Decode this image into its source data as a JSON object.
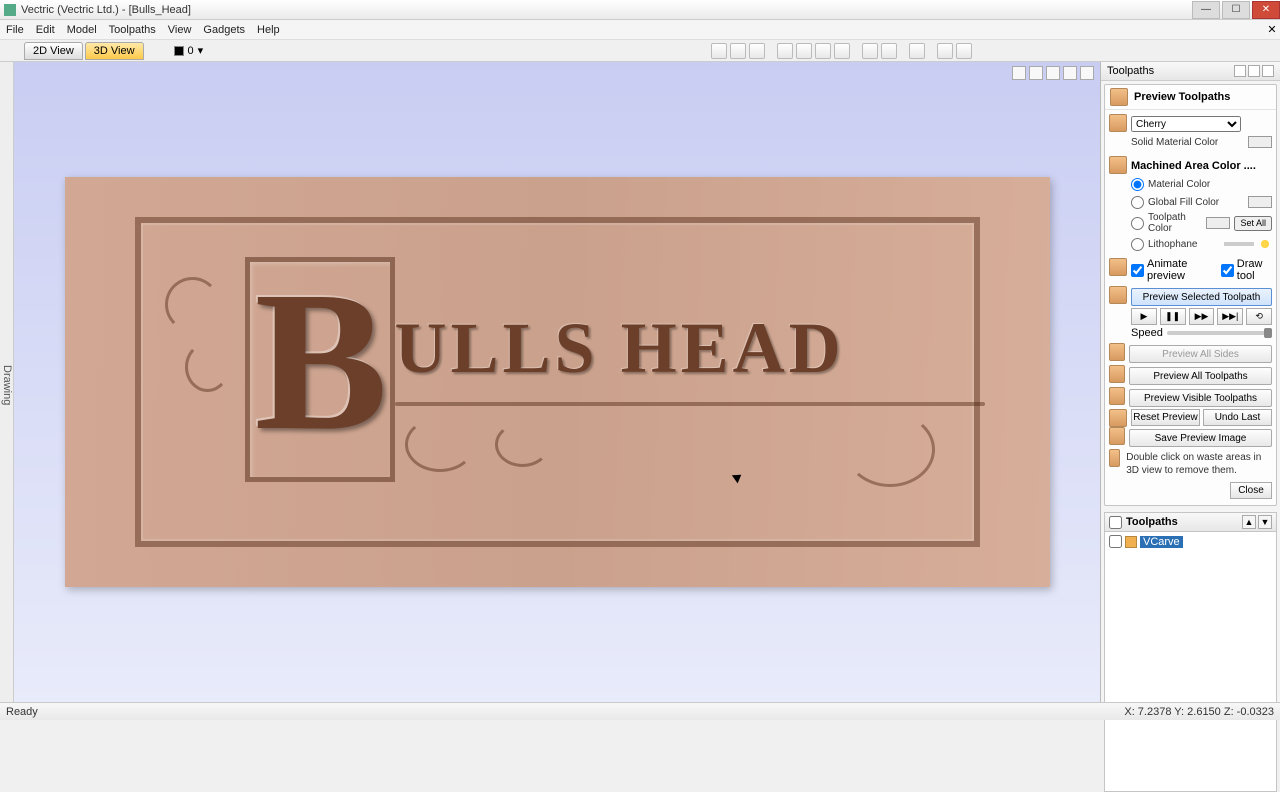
{
  "window": {
    "title": "Vectric (Vectric Ltd.) - [Bulls_Head]"
  },
  "menus": [
    "File",
    "Edit",
    "Model",
    "Toolpaths",
    "View",
    "Gadgets",
    "Help"
  ],
  "tabs": {
    "tab2d": "2D View",
    "tab3d": "3D View"
  },
  "layer": {
    "name": "0"
  },
  "sidebar_label": "Drawing",
  "carving_text": "ULLS HEAD",
  "rightpanel": {
    "header": "Toolpaths",
    "title": "Preview Toolpaths",
    "material_select": "Cherry",
    "solid_material_color": "Solid Material Color",
    "machined_area": "Machined Area Color ....",
    "opt_material": "Material Color",
    "opt_global": "Global Fill Color",
    "opt_toolpath": "Toolpath Color",
    "opt_litho": "Lithophane",
    "set_all": "Set All",
    "animate": "Animate preview",
    "drawtool": "Draw tool",
    "preview_selected": "Preview Selected Toolpath",
    "speed_label": "Speed",
    "preview_all_sides": "Preview All Sides",
    "preview_all": "Preview All Toolpaths",
    "preview_visible": "Preview Visible Toolpaths",
    "reset": "Reset Preview",
    "undo": "Undo Last",
    "save_img": "Save Preview Image",
    "hint": "Double click on waste areas in 3D view to remove them.",
    "close": "Close"
  },
  "toolpath_list": {
    "header": "Toolpaths",
    "item1": "VCarve"
  },
  "status": {
    "ready": "Ready",
    "coords": "X: 7.2378  Y: 2.6150  Z: -0.0323"
  }
}
